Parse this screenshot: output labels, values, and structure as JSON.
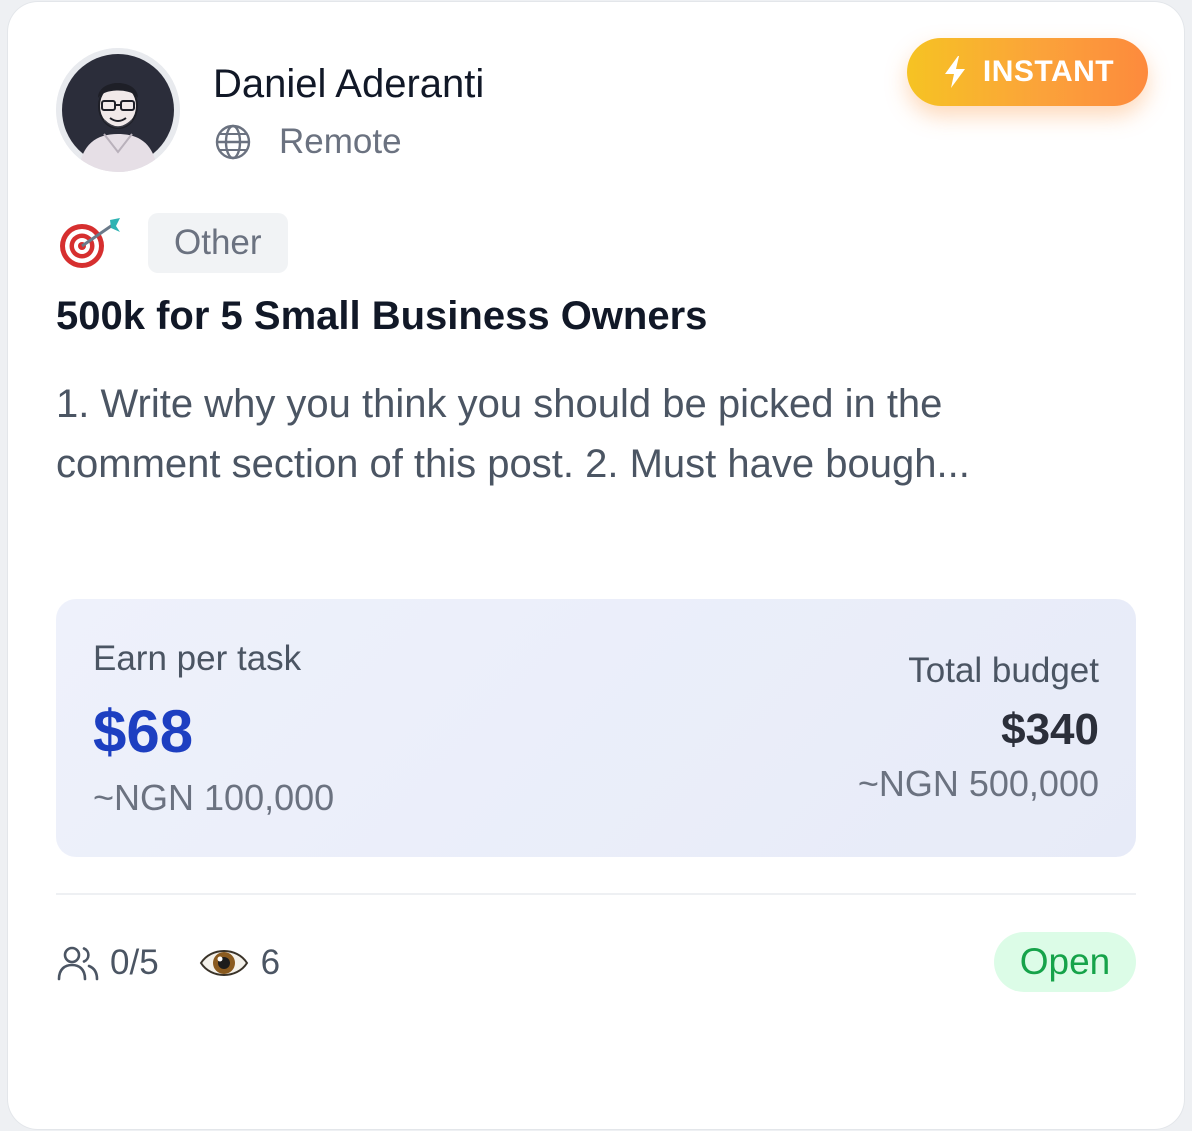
{
  "author": {
    "name": "Daniel Aderanti",
    "location": "Remote",
    "avatar_icon": "avatar-illustration",
    "location_icon": "globe-icon"
  },
  "badge": {
    "label": "INSTANT",
    "icon": "lightning-bolt-icon",
    "gradient": [
      "#f6c323",
      "#fd8a3d"
    ]
  },
  "category": {
    "icon": "target-dart-icon",
    "label": "Other"
  },
  "task": {
    "title": "500k for 5 Small Business Owners",
    "description": "1. Write why you think you should be picked in the comment section of this post. 2. Must have bough..."
  },
  "earnings": {
    "per_task_label": "Earn per task",
    "per_task_amount": "$68",
    "per_task_local": "~NGN 100,000",
    "budget_label": "Total budget",
    "budget_amount": "$340",
    "budget_local": "~NGN 500,000",
    "accent_color": "#1d3fc1"
  },
  "footer": {
    "participants": "0/5",
    "participants_icon": "users-icon",
    "views": "6",
    "views_icon": "eye-icon",
    "status": "Open",
    "status_color": "#16a34a"
  }
}
